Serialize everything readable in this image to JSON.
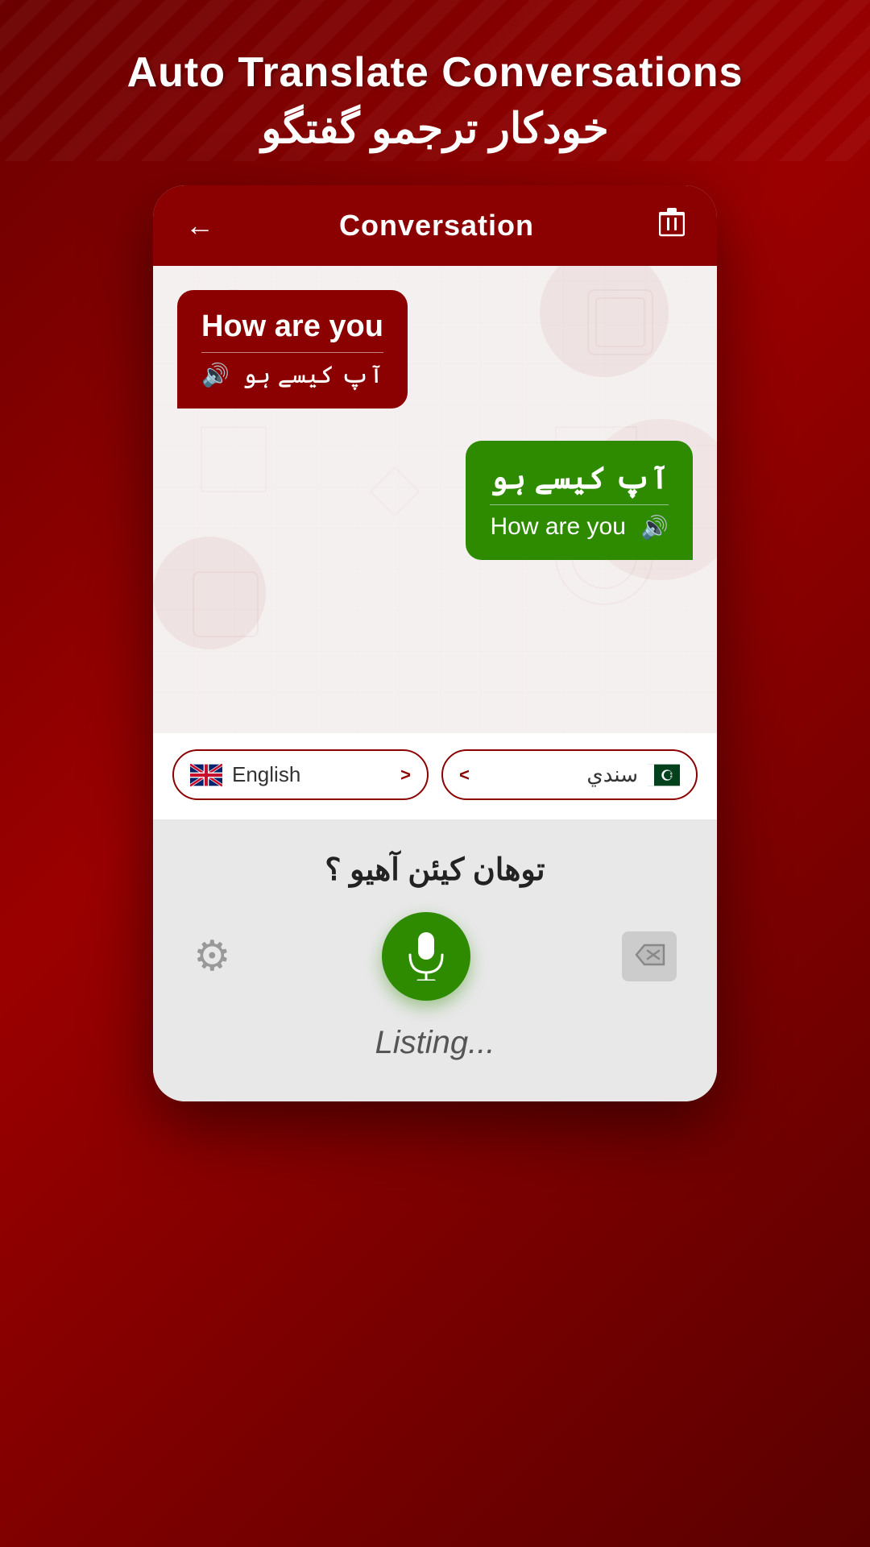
{
  "header": {
    "title_en": "Auto Translate Conversations",
    "title_ur": "خودکار ترجمو گفتگو"
  },
  "conversation": {
    "title": "Conversation",
    "back_label": "←",
    "delete_label": "🗑"
  },
  "messages": [
    {
      "id": "msg1",
      "side": "left",
      "main_text": "How are you",
      "secondary_text": "آپ کیسے ہو",
      "has_speaker": true
    },
    {
      "id": "msg2",
      "side": "right",
      "main_text": "آپ کیسے ہو",
      "secondary_text": "How are you",
      "has_speaker": true
    }
  ],
  "language_selectors": [
    {
      "id": "lang1",
      "flag": "uk",
      "label": "English"
    },
    {
      "id": "lang2",
      "flag": "pk",
      "label": "سندي"
    }
  ],
  "bottom_panel": {
    "recognized_text": "توهان كيئن آهيو ؟",
    "listing_label": "Listing...",
    "settings_label": "⚙",
    "delete_label": "⌫",
    "mic_label": "microphone"
  }
}
